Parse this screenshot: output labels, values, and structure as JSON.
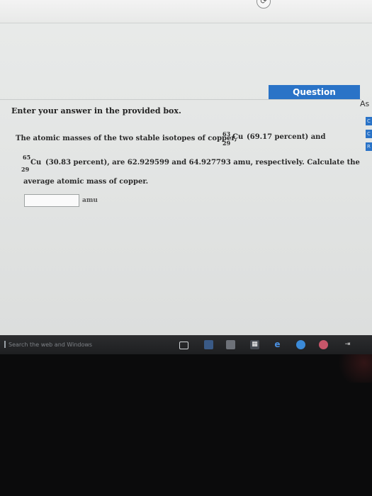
{
  "header": {
    "question_tab_label": "Question",
    "side_tab_label": "As",
    "side_chips": [
      "C",
      "C",
      "R"
    ]
  },
  "instructions": "Enter your answer in the provided box.",
  "question": {
    "line1_text": "The atomic masses of the two stable isotopes of copper,",
    "iso1_mass": "63",
    "iso1_atomic": "29",
    "iso1_symbol": "Cu",
    "iso1_abundance": "(69.17 percent) and",
    "iso2_mass": "65",
    "iso2_atomic": "29",
    "iso2_symbol": "Cu",
    "line2_text": "(30.83 percent), are 62.929599 and 64.927793 amu, respectively. Calculate the",
    "line3_text": "average atomic mass of copper."
  },
  "answer": {
    "value": "",
    "unit": "amu"
  },
  "taskbar": {
    "search_placeholder": "Search the web and Windows",
    "icons": [
      "task-view-icon",
      "file-explorer-icon",
      "store-icon",
      "edge-icon",
      "media-player-icon",
      "app-icon",
      "arrow-app-icon"
    ]
  }
}
